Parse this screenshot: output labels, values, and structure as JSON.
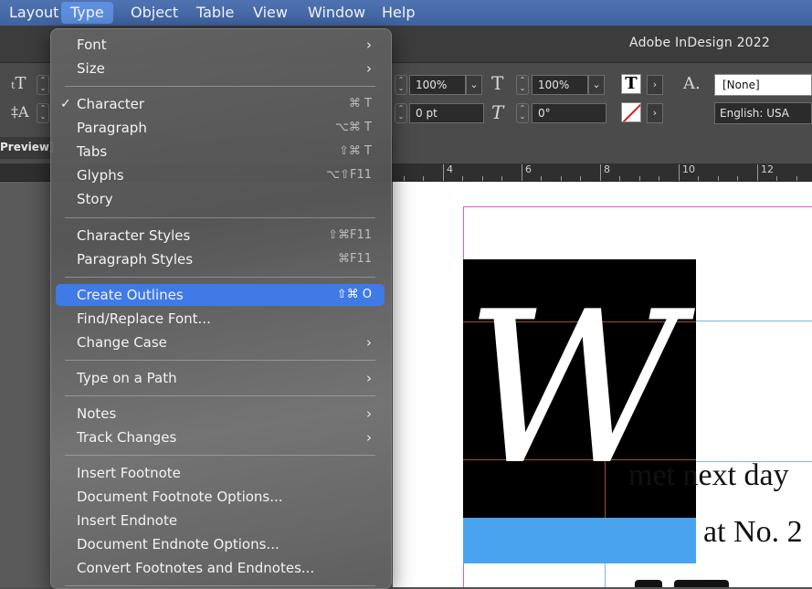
{
  "menubar": {
    "items": [
      "Layout",
      "Type",
      "Object",
      "Table",
      "View",
      "Window",
      "Help"
    ],
    "active": "Type"
  },
  "app": {
    "title": "Adobe InDesign 2022"
  },
  "control": {
    "scale1": "100%",
    "scale2": "100%",
    "baseline": "0 pt",
    "skew": "0°",
    "char_style": "[None]",
    "language": "English: USA"
  },
  "tab": {
    "label": "Preview]"
  },
  "ruler": {
    "labels": [
      "4",
      "6",
      "8",
      "10",
      "12"
    ]
  },
  "menu": {
    "items": [
      {
        "label": "Font",
        "submenu": true
      },
      {
        "label": "Size",
        "submenu": true
      },
      {
        "label": "Character",
        "shortcut": "⌘ T",
        "checked": true
      },
      {
        "label": "Paragraph",
        "shortcut": "⌥⌘ T"
      },
      {
        "label": "Tabs",
        "shortcut": "⇧⌘ T"
      },
      {
        "label": "Glyphs",
        "shortcut": "⌥⇧F11"
      },
      {
        "label": "Story"
      },
      {
        "label": "Character Styles",
        "shortcut": "⇧⌘F11"
      },
      {
        "label": "Paragraph Styles",
        "shortcut": "⌘F11"
      },
      {
        "label": "Create Outlines",
        "shortcut": "⇧⌘ O",
        "highlighted": true
      },
      {
        "label": "Find/Replace Font..."
      },
      {
        "label": "Change Case",
        "submenu": true
      },
      {
        "label": "Type on a Path",
        "submenu": true
      },
      {
        "label": "Notes",
        "submenu": true
      },
      {
        "label": "Track Changes",
        "submenu": true
      },
      {
        "label": "Insert Footnote"
      },
      {
        "label": "Document Footnote Options..."
      },
      {
        "label": "Insert Endnote"
      },
      {
        "label": "Document Endnote Options..."
      },
      {
        "label": "Convert Footnotes and Endnotes..."
      }
    ]
  },
  "document": {
    "drop_cap": "W",
    "line1": "met next day",
    "line2": "at No. 2",
    "colors": {
      "frame": "#000000",
      "highlight": "#4aa3ee",
      "guide_magenta": "#e05ad0",
      "guide_blue": "#7fb2e6"
    }
  }
}
